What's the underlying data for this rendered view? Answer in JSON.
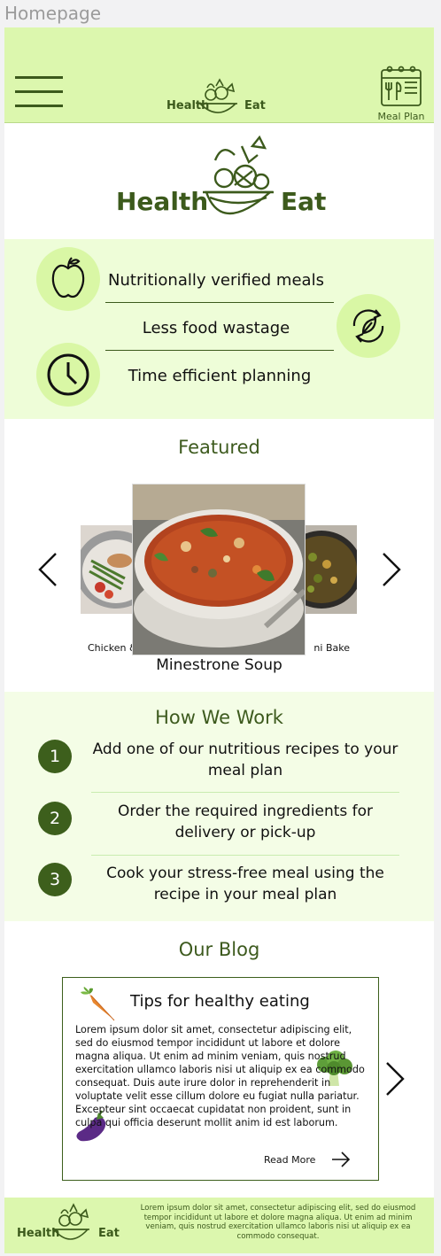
{
  "frame_label": "Homepage",
  "header": {
    "menu_icon": "hamburger-menu-icon",
    "logo_text_left": "Health",
    "logo_text_right": "Eat",
    "meal_plan_label": "Meal Plan",
    "meal_plan_icon": "calendar-cutlery-icon"
  },
  "hero": {
    "logo_text_left": "Health",
    "logo_text_right": "Eat"
  },
  "features": {
    "items": [
      {
        "icon": "apple-icon",
        "text": "Nutritionally verified meals"
      },
      {
        "icon": "recycle-leaf-icon",
        "text": "Less food wastage"
      },
      {
        "icon": "clock-icon",
        "text": "Time efficient planning"
      }
    ]
  },
  "featured": {
    "title": "Featured",
    "left_caption": "Chicken & Veg",
    "main_caption": "Minestrone Soup",
    "right_caption": "Zucchini Bake"
  },
  "how": {
    "title": "How We Work",
    "steps": [
      {
        "num": "1",
        "text": "Add one of our nutritious recipes to your meal plan"
      },
      {
        "num": "2",
        "text": "Order the required ingredients for delivery or pick-up"
      },
      {
        "num": "3",
        "text": "Cook your stress-free meal using the recipe in your meal plan"
      }
    ]
  },
  "blog": {
    "title": "Our Blog",
    "card_title": "Tips for healthy eating",
    "body": "Lorem ipsum dolor sit amet, consectetur adipiscing elit, sed do eiusmod tempor incididunt ut labore et dolore magna aliqua. Ut enim ad minim veniam, quis nostrud exercitation ullamco laboris nisi ut aliquip ex ea commodo consequat. Duis aute irure dolor in reprehenderit in voluptate velit esse cillum dolore eu fugiat nulla pariatur. Excepteur sint occaecat cupidatat non proident, sunt in culpa qui officia deserunt mollit anim id est laborum.",
    "read_more": "Read More"
  },
  "footer": {
    "logo_text_left": "Health",
    "logo_text_right": "Eat",
    "text": "Lorem ipsum dolor sit amet, consectetur adipiscing elit, sed do eiusmod tempor incididunt ut labore et dolore magna aliqua. Ut enim ad minim veniam, quis nostrud exercitation ullamco laboris nisi ut aliquip ex ea commodo consequat."
  },
  "colors": {
    "brand_green": "#3d5f1c",
    "header_bg": "#dcf7ae",
    "feature_bg": "#eefdd8",
    "how_bg": "#f4fde6"
  }
}
